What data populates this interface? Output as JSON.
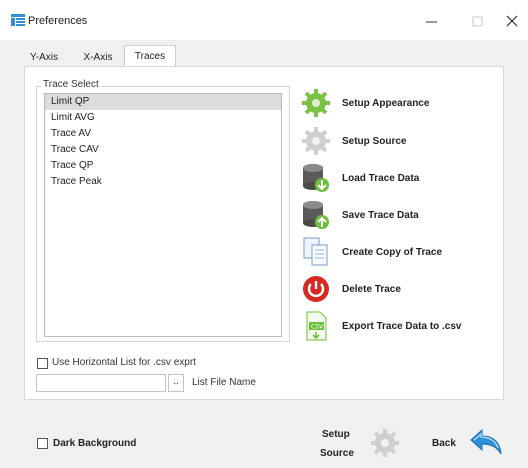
{
  "window": {
    "title": "Preferences",
    "controls": {
      "minimize": "—",
      "maximize": "☐",
      "close": "✕"
    }
  },
  "tabs": [
    {
      "label": "Y-Axis",
      "active": false
    },
    {
      "label": "X-Axis",
      "active": false
    },
    {
      "label": "Traces",
      "active": true
    }
  ],
  "trace_select": {
    "legend": "Trace Select",
    "items": [
      "Limit QP",
      "Limit AVG",
      "Trace AV",
      "Trace CAV",
      "Trace QP",
      "Trace Peak"
    ],
    "selected_index": 0
  },
  "actions": [
    {
      "label": "Setup Appearance",
      "icon": "gear-green-icon"
    },
    {
      "label": "Setup Source",
      "icon": "gear-gray-icon"
    },
    {
      "label": "Load Trace Data",
      "icon": "database-load-icon"
    },
    {
      "label": "Save Trace Data",
      "icon": "database-save-icon"
    },
    {
      "label": "Create Copy of Trace",
      "icon": "copy-documents-icon"
    },
    {
      "label": "Delete Trace",
      "icon": "power-delete-icon"
    },
    {
      "label": "Export Trace Data to .csv",
      "icon": "csv-export-icon"
    }
  ],
  "csv_options": {
    "horizontal_list_label": "Use Horizontal List for .csv exprt",
    "horizontal_list_checked": false,
    "file_name_value": "",
    "browse_label": "..",
    "file_name_label": "List File Name"
  },
  "footer": {
    "dark_background_label": "Dark Background",
    "dark_background_checked": false,
    "setup_source_line1": "Setup",
    "setup_source_line2": "Source",
    "back_label": "Back"
  },
  "colors": {
    "accent_green": "#7cc242",
    "accent_blue": "#2f8fd8",
    "delete_red": "#d42a22",
    "selection_gray": "#dcdcdc"
  }
}
